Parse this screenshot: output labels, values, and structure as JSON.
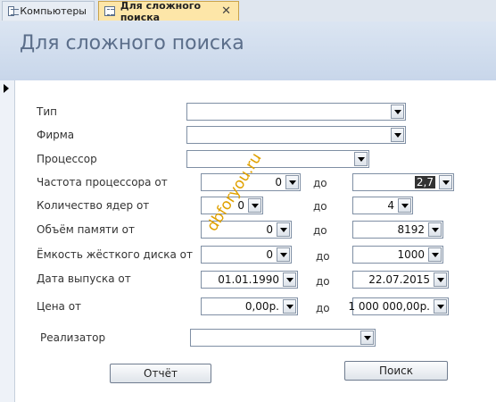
{
  "tabs": [
    {
      "label": "Компьютеры"
    },
    {
      "label": "Для сложного поиска"
    }
  ],
  "header": {
    "title": "Для сложного поиска"
  },
  "fields": {
    "type": {
      "label": "Тип",
      "value": ""
    },
    "firm": {
      "label": "Фирма",
      "value": ""
    },
    "processor": {
      "label": "Процессор",
      "value": ""
    },
    "cpu_freq": {
      "label": "Частота процессора от",
      "from": "0",
      "to_label": "до",
      "to": "2,7"
    },
    "cores": {
      "label": "Количество ядер от",
      "from": "0",
      "to_label": "до",
      "to": "4"
    },
    "memory": {
      "label": "Объём памяти от",
      "from": "0",
      "to_label": "до",
      "to": "8192"
    },
    "disk": {
      "label": "Ёмкость жёсткого диска от",
      "from": "0",
      "to_label": "до",
      "to": "1000"
    },
    "release_date": {
      "label": "Дата выпуска от",
      "from": "01.01.1990",
      "to_label": "до",
      "to": "22.07.2015"
    },
    "price": {
      "label": "Цена от",
      "from": "0,00р.",
      "to_label": "до",
      "to": "1 000 000,00р."
    },
    "seller": {
      "label": "Реализатор",
      "value": ""
    }
  },
  "buttons": {
    "report": "Отчёт",
    "search": "Поиск"
  },
  "watermark": "dbforyou.ru",
  "colors": {
    "active_tab": "#fde6a8",
    "header_bg": "#c8d6ea",
    "title_text": "#5b6e8a",
    "watermark": "#e0a100"
  },
  "icons": {
    "tab_icon": "form-icon",
    "close": "close-icon",
    "dropdown": "chevron-down-icon",
    "record": "record-selector-arrow-icon"
  }
}
